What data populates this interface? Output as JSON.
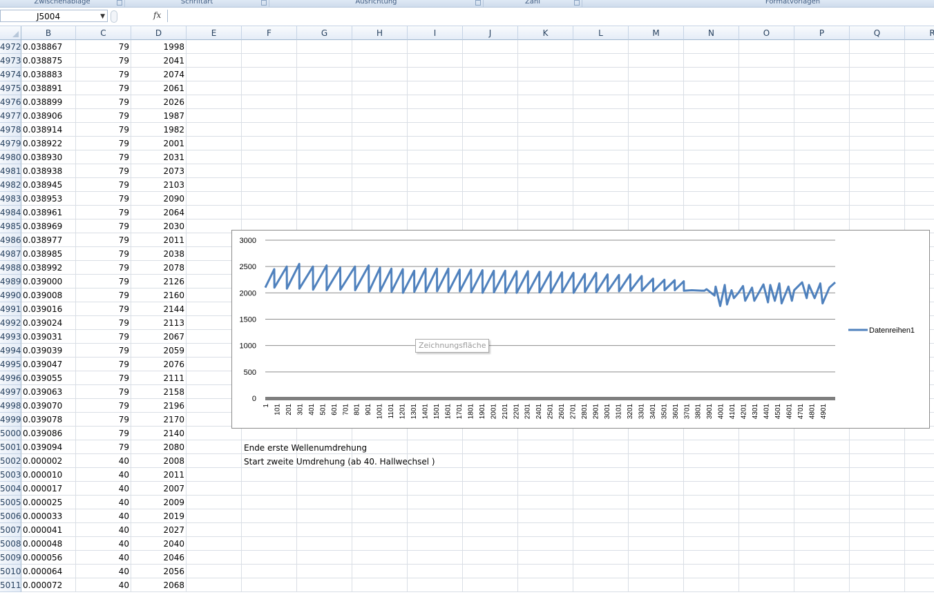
{
  "ribbon": {
    "groups": [
      "Zwischenablage",
      "Schriftart",
      "Ausrichtung",
      "Zahl",
      "Formatvorlagen"
    ]
  },
  "formula_bar": {
    "name_box": "J5004",
    "fx_label": "fx",
    "formula": ""
  },
  "columns": [
    "B",
    "C",
    "D",
    "E",
    "F",
    "G",
    "H",
    "I",
    "J",
    "K",
    "L",
    "M",
    "N",
    "O",
    "P",
    "Q",
    "R"
  ],
  "rows": [
    {
      "num": "4972",
      "b": "0.038867",
      "c": "79",
      "d": "1998"
    },
    {
      "num": "4973",
      "b": "0.038875",
      "c": "79",
      "d": "2041"
    },
    {
      "num": "4974",
      "b": "0.038883",
      "c": "79",
      "d": "2074"
    },
    {
      "num": "4975",
      "b": "0.038891",
      "c": "79",
      "d": "2061"
    },
    {
      "num": "4976",
      "b": "0.038899",
      "c": "79",
      "d": "2026"
    },
    {
      "num": "4977",
      "b": "0.038906",
      "c": "79",
      "d": "1987"
    },
    {
      "num": "4978",
      "b": "0.038914",
      "c": "79",
      "d": "1982"
    },
    {
      "num": "4979",
      "b": "0.038922",
      "c": "79",
      "d": "2001"
    },
    {
      "num": "4980",
      "b": "0.038930",
      "c": "79",
      "d": "2031"
    },
    {
      "num": "4981",
      "b": "0.038938",
      "c": "79",
      "d": "2073"
    },
    {
      "num": "4982",
      "b": "0.038945",
      "c": "79",
      "d": "2103"
    },
    {
      "num": "4983",
      "b": "0.038953",
      "c": "79",
      "d": "2090"
    },
    {
      "num": "4984",
      "b": "0.038961",
      "c": "79",
      "d": "2064"
    },
    {
      "num": "4985",
      "b": "0.038969",
      "c": "79",
      "d": "2030"
    },
    {
      "num": "4986",
      "b": "0.038977",
      "c": "79",
      "d": "2011"
    },
    {
      "num": "4987",
      "b": "0.038985",
      "c": "79",
      "d": "2038"
    },
    {
      "num": "4988",
      "b": "0.038992",
      "c": "79",
      "d": "2078"
    },
    {
      "num": "4989",
      "b": "0.039000",
      "c": "79",
      "d": "2126"
    },
    {
      "num": "4990",
      "b": "0.039008",
      "c": "79",
      "d": "2160"
    },
    {
      "num": "4991",
      "b": "0.039016",
      "c": "79",
      "d": "2144"
    },
    {
      "num": "4992",
      "b": "0.039024",
      "c": "79",
      "d": "2113"
    },
    {
      "num": "4993",
      "b": "0.039031",
      "c": "79",
      "d": "2067"
    },
    {
      "num": "4994",
      "b": "0.039039",
      "c": "79",
      "d": "2059"
    },
    {
      "num": "4995",
      "b": "0.039047",
      "c": "79",
      "d": "2076"
    },
    {
      "num": "4996",
      "b": "0.039055",
      "c": "79",
      "d": "2111"
    },
    {
      "num": "4997",
      "b": "0.039063",
      "c": "79",
      "d": "2158"
    },
    {
      "num": "4998",
      "b": "0.039070",
      "c": "79",
      "d": "2196"
    },
    {
      "num": "4999",
      "b": "0.039078",
      "c": "79",
      "d": "2170"
    },
    {
      "num": "5000",
      "b": "0.039086",
      "c": "79",
      "d": "2140"
    },
    {
      "num": "5001",
      "b": "0.039094",
      "c": "79",
      "d": "2080"
    },
    {
      "num": "5002",
      "b": "0.000002",
      "c": "40",
      "d": "2008"
    },
    {
      "num": "5003",
      "b": "0.000010",
      "c": "40",
      "d": "2011"
    },
    {
      "num": "5004",
      "b": "0.000017",
      "c": "40",
      "d": "2007"
    },
    {
      "num": "5005",
      "b": "0.000025",
      "c": "40",
      "d": "2009"
    },
    {
      "num": "5006",
      "b": "0.000033",
      "c": "40",
      "d": "2019"
    },
    {
      "num": "5007",
      "b": "0.000041",
      "c": "40",
      "d": "2027"
    },
    {
      "num": "5008",
      "b": "0.000048",
      "c": "40",
      "d": "2040"
    },
    {
      "num": "5009",
      "b": "0.000056",
      "c": "40",
      "d": "2046"
    },
    {
      "num": "5010",
      "b": "0.000064",
      "c": "40",
      "d": "2056"
    },
    {
      "num": "5011",
      "b": "0.000072",
      "c": "40",
      "d": "2068"
    }
  ],
  "notes": {
    "end_first": "Ende erste Wellenumdrehung",
    "start_second": "Start zweite Umdrehung (ab 40. Hallwechsel )"
  },
  "tooltip": "Zeichnungsfläche",
  "chart_data": {
    "type": "line",
    "ylim": [
      0,
      3000
    ],
    "yticks": [
      0,
      500,
      1000,
      1500,
      2000,
      2500,
      3000
    ],
    "grid": true,
    "legend": "right",
    "xtick_labels": [
      "1",
      "101",
      "201",
      "301",
      "401",
      "501",
      "601",
      "701",
      "801",
      "901",
      "1001",
      "1101",
      "1201",
      "1301",
      "1401",
      "1501",
      "1601",
      "1701",
      "1801",
      "1901",
      "2001",
      "2101",
      "2201",
      "2301",
      "2401",
      "2501",
      "2601",
      "2701",
      "2801",
      "2901",
      "3001",
      "3101",
      "3201",
      "3301",
      "3401",
      "3501",
      "3601",
      "3701",
      "3801",
      "3901",
      "4001",
      "4101",
      "4201",
      "4301",
      "4401",
      "4501",
      "4601",
      "4701",
      "4801",
      "4901"
    ],
    "x_count": 5011,
    "series_color": "#4f81bd",
    "series": [
      {
        "name": "Datenreihen1",
        "x": [
          1,
          80,
          81,
          190,
          191,
          300,
          301,
          420,
          421,
          540,
          541,
          660,
          661,
          790,
          791,
          910,
          911,
          1010,
          1011,
          1110,
          1111,
          1210,
          1211,
          1310,
          1311,
          1410,
          1411,
          1510,
          1511,
          1610,
          1611,
          1710,
          1711,
          1810,
          1811,
          1910,
          1911,
          2010,
          2011,
          2110,
          2111,
          2210,
          2211,
          2310,
          2311,
          2410,
          2411,
          2510,
          2511,
          2610,
          2611,
          2710,
          2711,
          2810,
          2811,
          2910,
          2911,
          3010,
          3011,
          3110,
          3111,
          3210,
          3211,
          3310,
          3311,
          3410,
          3411,
          3510,
          3511,
          3600,
          3601,
          3680,
          3681,
          3750,
          3860,
          3880,
          3950,
          3960,
          4000,
          4040,
          4060,
          4100,
          4120,
          4160,
          4200,
          4220,
          4280,
          4300,
          4380,
          4420,
          4440,
          4480,
          4520,
          4540,
          4600,
          4630,
          4650,
          4720,
          4760,
          4780,
          4830,
          4880,
          4900,
          4960,
          5011
        ],
        "y": [
          2100,
          2450,
          2100,
          2500,
          2080,
          2550,
          2080,
          2500,
          2060,
          2520,
          2050,
          2480,
          2060,
          2500,
          2050,
          2520,
          2020,
          2480,
          2030,
          2460,
          2020,
          2450,
          2000,
          2420,
          2020,
          2460,
          2020,
          2460,
          2030,
          2460,
          2020,
          2440,
          2030,
          2440,
          2010,
          2430,
          2000,
          2420,
          2010,
          2420,
          2000,
          2410,
          2000,
          2410,
          2000,
          2400,
          2010,
          2400,
          2000,
          2390,
          2010,
          2380,
          2000,
          2360,
          2020,
          2380,
          2010,
          2350,
          2030,
          2340,
          2030,
          2350,
          2040,
          2320,
          2040,
          2270,
          2030,
          2250,
          2050,
          2240,
          2050,
          2220,
          2040,
          2050,
          2040,
          2070,
          1950,
          2120,
          1750,
          2150,
          1780,
          2050,
          1900,
          2000,
          2130,
          1850,
          2100,
          1850,
          2160,
          1820,
          2150,
          1850,
          2180,
          1800,
          2120,
          1850,
          2050,
          2200,
          1900,
          2150,
          1900,
          2180,
          1800,
          2100,
          2200
        ]
      }
    ]
  }
}
